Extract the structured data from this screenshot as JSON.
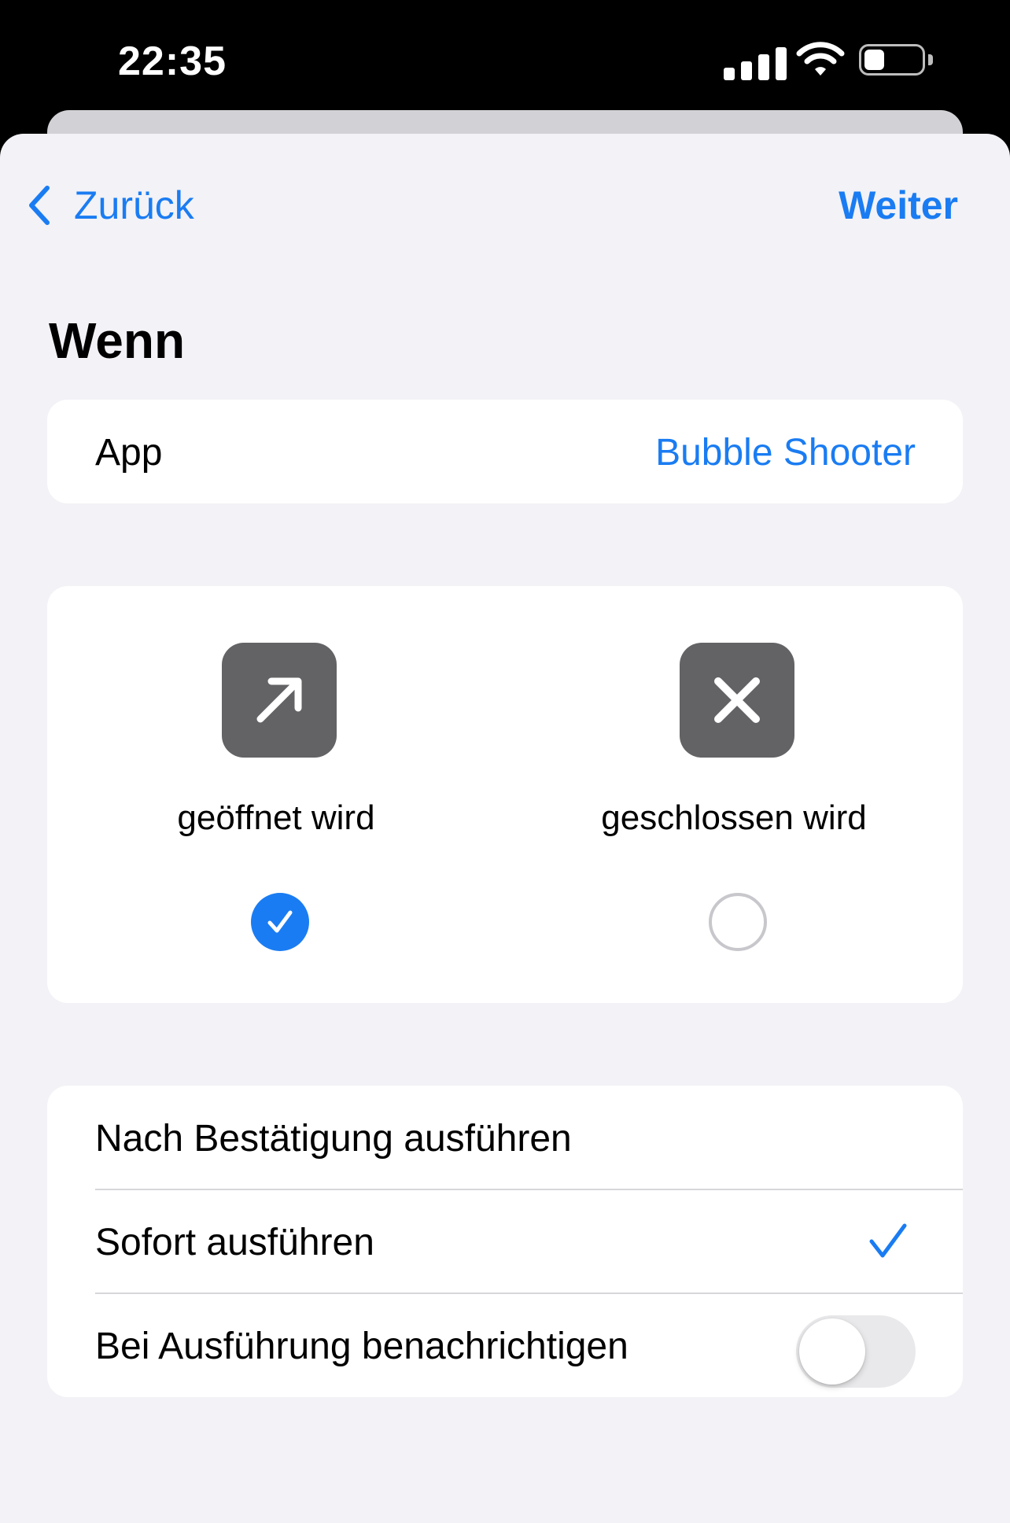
{
  "status_bar": {
    "time": "22:35",
    "icons": [
      "signal-icon",
      "wifi-icon",
      "battery-icon"
    ],
    "battery_level": 0.35
  },
  "nav": {
    "back_label": "Zurück",
    "next_label": "Weiter"
  },
  "section": {
    "title": "Wenn"
  },
  "app_row": {
    "label": "App",
    "value": "Bubble Shooter"
  },
  "trigger_options": [
    {
      "label": "geöffnet wird",
      "icon": "arrow-up-right-icon",
      "selected": true
    },
    {
      "label": "geschlossen wird",
      "icon": "xmark-icon",
      "selected": false
    }
  ],
  "settings": {
    "ask_before_running": "Nach Bestätigung ausführen",
    "run_immediately": "Sofort ausführen",
    "run_immediately_checked": true,
    "notify_when_run": "Bei Ausführung benachrichtigen",
    "notify_when_run_on": false
  },
  "colors": {
    "accent": "#1a7cf2",
    "background": "#f2f2f7",
    "tile": "#636366"
  }
}
